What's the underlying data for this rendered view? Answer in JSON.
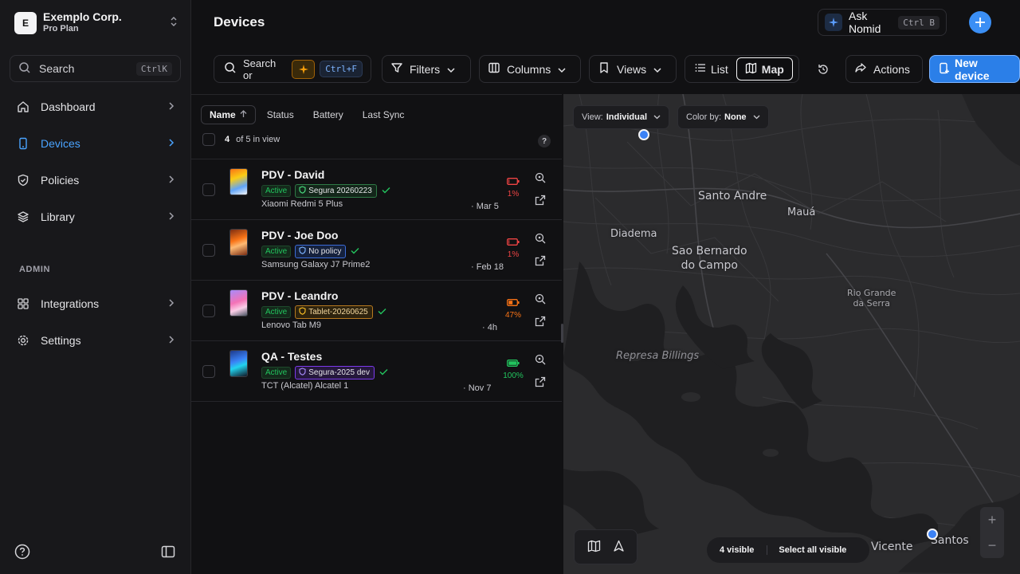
{
  "org": {
    "initial": "E",
    "name": "Exemplo Corp.",
    "plan": "Pro Plan"
  },
  "sidebar": {
    "search_label": "Search",
    "search_shortcut": "CtrlK",
    "items": [
      {
        "label": "Dashboard",
        "icon": "home-icon"
      },
      {
        "label": "Devices",
        "icon": "device-icon",
        "active": true
      },
      {
        "label": "Policies",
        "icon": "shield-icon"
      },
      {
        "label": "Library",
        "icon": "layers-icon"
      }
    ],
    "admin_label": "ADMIN",
    "admin_items": [
      {
        "label": "Integrations",
        "icon": "grid-icon"
      },
      {
        "label": "Settings",
        "icon": "gear-icon"
      }
    ]
  },
  "header": {
    "title": "Devices",
    "ask_label": "Ask Nomid",
    "ask_shortcut": "Ctrl B"
  },
  "toolbar": {
    "search_label": "Search or",
    "search_shortcut": "Ctrl+F",
    "filters": "Filters",
    "columns": "Columns",
    "views": "Views",
    "list": "List",
    "map": "Map",
    "actions": "Actions",
    "new_device": "New device"
  },
  "list": {
    "sort_columns": [
      "Name",
      "Status",
      "Battery",
      "Last Sync"
    ],
    "count": "4",
    "count_text": "of 5 in view",
    "help": "?",
    "devices": [
      {
        "name": "PDV - David",
        "status": "Active",
        "policy": "Segura 20260223",
        "model": "Xiaomi Redmi 5 Plus",
        "date": "· Mar 5",
        "battery_pct": "1%",
        "battery_level": 0.01,
        "battery_color": "#ef4444"
      },
      {
        "name": "PDV - Joe Doo",
        "status": "Active",
        "policy": "No policy",
        "model": "Samsung Galaxy J7 Prime2",
        "date": "· Feb 18",
        "battery_pct": "1%",
        "battery_level": 0.01,
        "battery_color": "#ef4444"
      },
      {
        "name": "PDV - Leandro",
        "status": "Active",
        "policy": "Tablet-20260625",
        "model": "Lenovo Tab M9",
        "date": "· 4h",
        "battery_pct": "47%",
        "battery_level": 0.47,
        "battery_color": "#f97316"
      },
      {
        "name": "QA - Testes",
        "status": "Active",
        "policy": "Segura-2025 dev",
        "model": "TCT (Alcatel) Alcatel 1",
        "date": "· Nov 7",
        "battery_pct": "100%",
        "battery_level": 1.0,
        "battery_color": "#22c55e"
      }
    ]
  },
  "map": {
    "view_label": "View:",
    "view_value": "Individual",
    "color_label": "Color by:",
    "color_value": "None",
    "places": {
      "santo_andre": "Santo Andre",
      "maua": "Mauá",
      "diadema": "Diadema",
      "sao_bernardo_1": "Sao Bernardo",
      "sao_bernardo_2": "do Campo",
      "rio_grande_1": "Rio Grande",
      "rio_grande_2": "da Serra",
      "represa": "Represa Billings",
      "vicente": "Vicente",
      "santos": "Santos"
    },
    "visible_count": "4 visible",
    "select_all": "Select all visible",
    "zoom_in": "+",
    "zoom_out": "−"
  }
}
